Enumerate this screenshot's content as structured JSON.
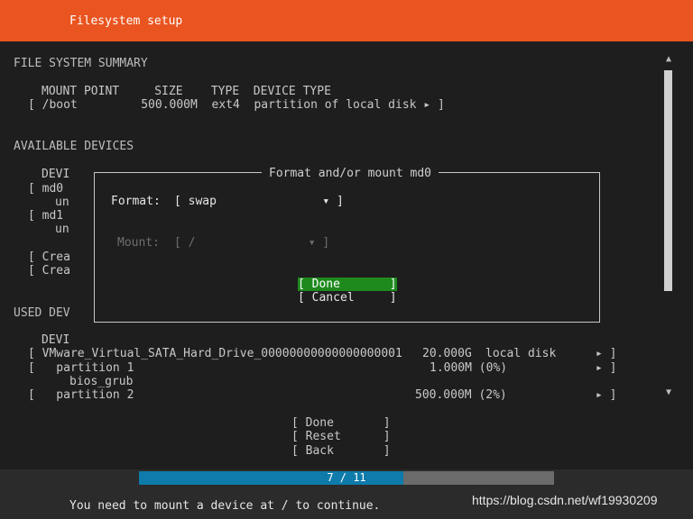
{
  "header": {
    "title": "Filesystem setup"
  },
  "summary": {
    "title": "FILE SYSTEM SUMMARY",
    "columns_line": "MOUNT POINT     SIZE    TYPE  DEVICE TYPE",
    "row": "[ /boot         500.000M  ext4  partition of local disk ▸ ]"
  },
  "available": {
    "title": "AVAILABLE DEVICES",
    "col_header": "DEVI",
    "rows": [
      "[ md0",
      "un",
      "[ md1",
      "un",
      "[ Crea",
      "[ Crea"
    ]
  },
  "used": {
    "title": "USED DEV",
    "col_header": "DEVI",
    "row1_left": "[ VMware_Virtual_SATA_Hard_Drive_00000000000000000001",
    "row1_size": "20.000G",
    "row1_type": "local disk",
    "row1_arrow": "▸ ]",
    "row2_left": "[   partition 1",
    "row2_size": "1.000M (0%)",
    "row2_arrow": "▸ ]",
    "row3": "bios_grub",
    "row4_left": "[   partition 2",
    "row4_size": "500.000M (2%)",
    "row4_arrow": "▸ ]"
  },
  "dialog": {
    "title": "Format and/or mount md0",
    "format_label": "Format:",
    "format_value": "[ swap               ▾ ]",
    "mount_label": "Mount:",
    "mount_value": "[ /                ▾ ]",
    "done_button": "[ Done       ]",
    "cancel_button": "[ Cancel     ]"
  },
  "actions": {
    "done": "[ Done       ]",
    "reset": "[ Reset      ]",
    "back": "[ Back       ]"
  },
  "scrollbar": {
    "up_icon": "▲",
    "down_icon": "▼"
  },
  "progress": {
    "label": "7 / 11",
    "value": 7,
    "max": 11
  },
  "status": {
    "message": "You need to mount a device at / to continue."
  },
  "watermark": {
    "text": "https://blog.csdn.net/wf19930209"
  },
  "colors": {
    "header": "#e95420",
    "focus": "#1e8a1e",
    "progress": "#0e7bab"
  }
}
